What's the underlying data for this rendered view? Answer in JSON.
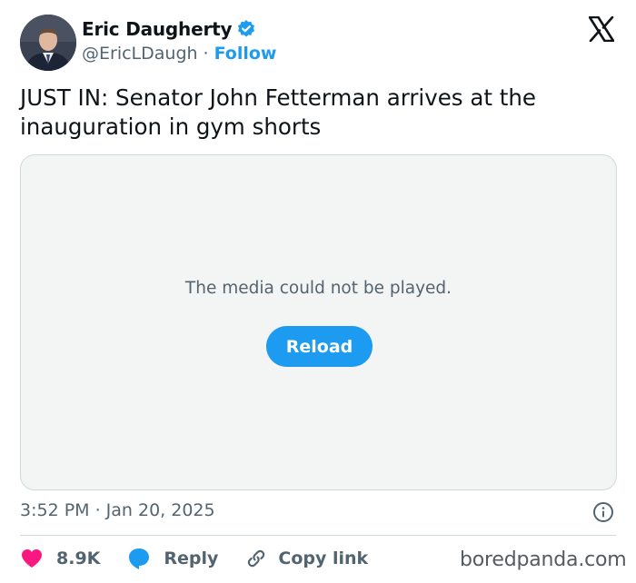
{
  "author": {
    "name": "Eric Daugherty",
    "handle": "@EricLDaugh",
    "separator": "·",
    "follow_label": "Follow",
    "verified_icon": "verified-badge-icon",
    "avatar_icon": "avatar"
  },
  "platform_icon": "x-logo-icon",
  "tweet": {
    "text": "JUST IN: Senator John Fetterman arrives at the inauguration in gym shorts"
  },
  "media": {
    "message": "The media could not be played.",
    "reload_label": "Reload"
  },
  "meta": {
    "timestamp": "3:52 PM · Jan 20, 2025",
    "info_icon": "info-icon"
  },
  "actions": {
    "like_count": "8.9K",
    "reply_label": "Reply",
    "copy_link_label": "Copy link"
  },
  "watermark": "boredpanda.com",
  "colors": {
    "accent": "#1d9bf0",
    "like": "#f91880",
    "text": "#0f1419",
    "secondary": "#536471",
    "media_bg": "#f3f4f4",
    "border": "#cfd9de"
  }
}
